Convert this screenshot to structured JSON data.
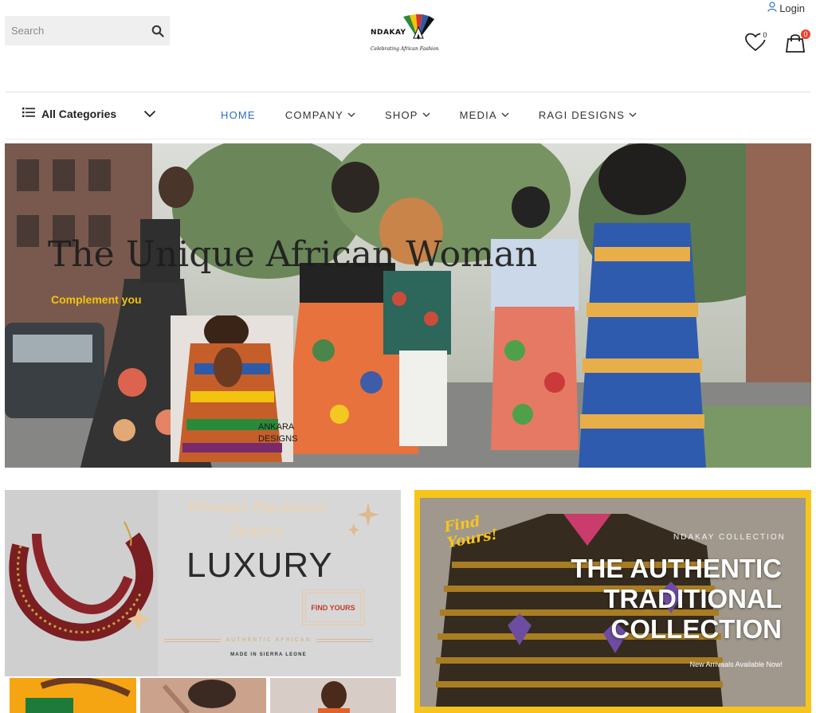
{
  "header": {
    "search_placeholder": "Search",
    "logo_text": "NDAKAY",
    "logo_tagline": "Celebrating African Fashion",
    "login_label": "Login",
    "wishlist_count": "0",
    "cart_count": "0"
  },
  "nav": {
    "all_categories": "All Categories",
    "items": [
      {
        "label": "HOME"
      },
      {
        "label": "COMPANY"
      },
      {
        "label": "SHOP"
      },
      {
        "label": "MEDIA"
      },
      {
        "label": "RAGI DESIGNS"
      }
    ]
  },
  "hero": {
    "title": "The Unique African Woman",
    "subtitle": "Complement you",
    "inset_label": "ANKARA\nDESIGNS"
  },
  "promo_left": {
    "script_title": "Women Necklace Jewlry",
    "heading": "LUXURY",
    "button": "FIND YOURS",
    "tagline": "AUTHENTIC AFRICAN",
    "origin": "MADE IN SIERRA LEONE"
  },
  "promo_right": {
    "badge": "Find\nYours!",
    "label": "NDAKAY COLLECTION",
    "title": "THE AUTHENTIC\nTRADITIONAL\nCOLLECTION",
    "subtitle": "New Arrivaals Available Now!"
  },
  "colors": {
    "accent_nav": "#2d6fbf",
    "hero_subtitle": "#f2c40f",
    "promo_border": "#f6c51c",
    "cart_badge": "#e8412b"
  }
}
